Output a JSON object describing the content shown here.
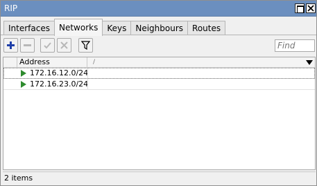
{
  "window": {
    "title": "RIP"
  },
  "tabs": [
    {
      "label": "Interfaces"
    },
    {
      "label": "Networks"
    },
    {
      "label": "Keys"
    },
    {
      "label": "Neighbours"
    },
    {
      "label": "Routes"
    }
  ],
  "active_tab": "Networks",
  "toolbar": {
    "add_icon": "plus-icon",
    "remove_icon": "minus-icon",
    "enable_icon": "check-icon",
    "disable_icon": "x-icon",
    "filter_icon": "funnel-icon",
    "find_placeholder": "Find"
  },
  "table": {
    "columns": [
      {
        "label": "Address",
        "sort_indicator": "/"
      }
    ],
    "rows": [
      {
        "address": "172.16.12.0/24",
        "icon": "green-arrow-icon"
      },
      {
        "address": "172.16.23.0/24",
        "icon": "green-arrow-icon"
      }
    ]
  },
  "status": {
    "items_text": "2 items"
  },
  "colors": {
    "title_bar": "#6b8fbf",
    "row_icon": "#2e8b2e",
    "add_icon": "#1f3fa8"
  }
}
